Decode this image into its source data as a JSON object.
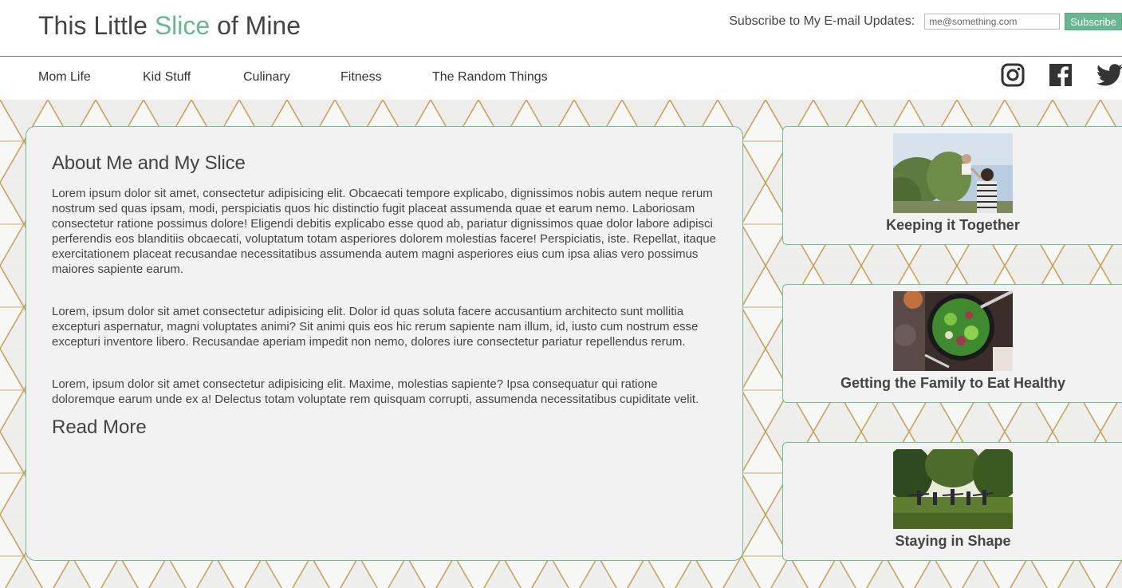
{
  "header": {
    "brand_part1": "This Little ",
    "brand_accent": "Slice",
    "brand_part2": " of Mine",
    "accent_color": "#66b891",
    "subscribe_label": "Subscribe to My E-mail Updates:",
    "email_placeholder": "me@something.com",
    "subscribe_button": "Subscribe"
  },
  "nav": {
    "items": [
      "Mom Life",
      "Kid Stuff",
      "Culinary",
      "Fitness",
      "The Random Things"
    ],
    "social": [
      "instagram-icon",
      "facebook-icon",
      "twitter-icon"
    ]
  },
  "main": {
    "title": "About Me and My Slice",
    "paragraphs": [
      "Lorem ipsum dolor sit amet, consectetur adipisicing elit. Obcaecati tempore explicabo, dignissimos nobis autem neque rerum nostrum sed quas ipsam, modi, perspiciatis quos hic distinctio fugit placeat assumenda quae et earum nemo. Laboriosam consectetur ratione possimus dolore! Eligendi debitis explicabo esse quod ab, pariatur dignissimos quae dolor labore adipisci perferendis eos blanditiis obcaecati, voluptatum totam asperiores dolorem molestias facere! Perspiciatis, iste. Repellat, itaque exercitationem placeat recusandae necessitatibus assumenda autem magni asperiores eius cum ipsa alias vero possimus maiores sapiente earum.",
      "Lorem, ipsum dolor sit amet consectetur adipisicing elit. Dolor id quas soluta facere accusantium architecto sunt mollitia excepturi aspernatur, magni voluptates animi? Sit animi quis eos hic rerum sapiente nam illum, id, iusto cum nostrum esse excepturi inventore libero. Recusandae aperiam impedit non nemo, dolores iure consectetur pariatur repellendus rerum.",
      "Lorem, ipsum dolor sit amet consectetur adipisicing elit. Maxime, molestias sapiente? Ipsa consequatur qui ratione doloremque earum unde ex a! Delectus totam voluptate rem quisquam corrupti, assumenda necessitatibus cupiditate velit."
    ],
    "read_more": "Read More"
  },
  "sidebar": {
    "cards": [
      {
        "title": "Keeping it Together",
        "image": "parent-lifting-child-photo"
      },
      {
        "title": "Getting the Family to Eat Healthy",
        "image": "salad-bowl-photo"
      },
      {
        "title": "Staying in Shape",
        "image": "outdoor-yoga-photo"
      }
    ]
  }
}
